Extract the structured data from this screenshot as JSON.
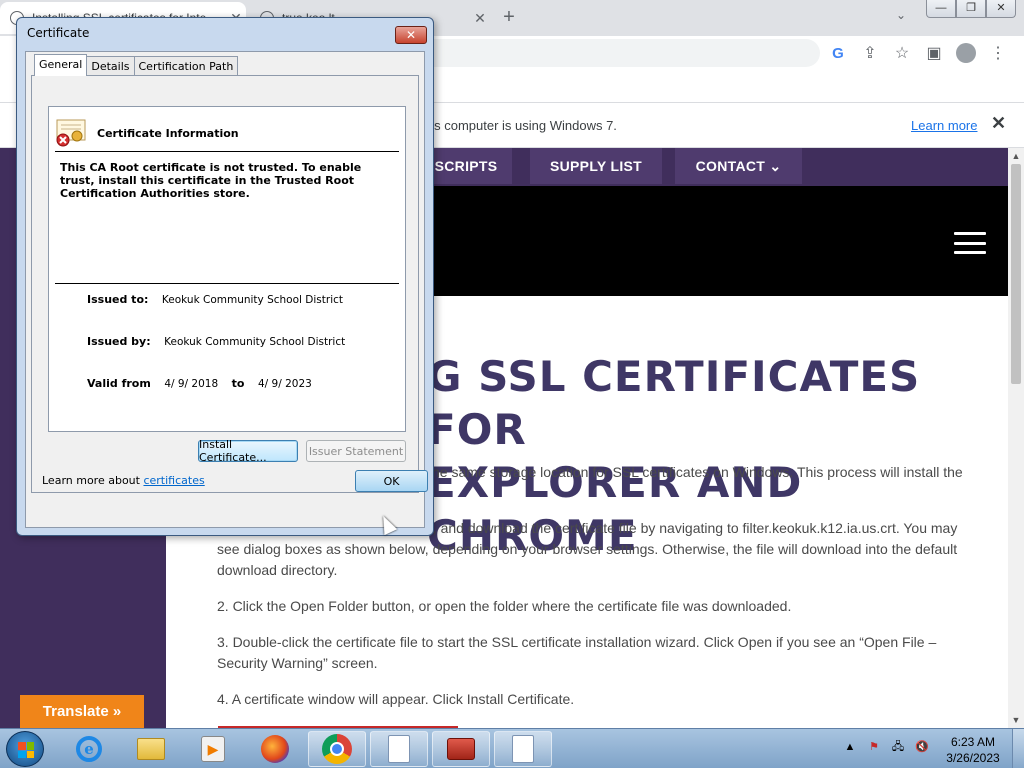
{
  "browser": {
    "tabs": [
      {
        "title": "Installing SSL certificates for Inte",
        "close": "✕"
      },
      {
        "title": "true.keo.lt",
        "close": "✕"
      }
    ],
    "new_tab": "+",
    "tab_search": "⌄",
    "window_controls": {
      "minimize": "—",
      "maximize": "❐",
      "close": "✕"
    },
    "toolbar_icons": [
      "google-icon",
      "share-icon",
      "star-icon",
      "sidepanel-icon",
      "profile-icon",
      "menu-icon"
    ],
    "toolbar": {
      "google": "G",
      "share": "⇪",
      "star": "☆",
      "sidepanel": "▣",
      "menu": "⋮"
    }
  },
  "infobar": {
    "text": "his computer is using Windows 7.",
    "link": "Learn more",
    "close": "✕"
  },
  "site": {
    "nav": [
      {
        "label": "SCRIPTS"
      },
      {
        "label": "SUPPLY LIST"
      },
      {
        "label": "CONTACT ⌄"
      }
    ],
    "heading_line1": "G SSL CERTIFICATES FOR",
    "heading_line2": "EXPLORER AND CHROME",
    "intro": "he same storage location for SSL certificates on Windows. This process will install the",
    "step1_a": "e, and download the certificate file by navigating to",
    "step1_link": "filter.keokuk.k12.ia.us.crt",
    "step1_b": ". You may see dialog boxes as shown below, depending on your browser settings. Otherwise, the file will download into the default download directory.",
    "step2": "2. Click the Open Folder button, or open the folder where the certificate file was downloaded.",
    "step3": "3. Double-click the certificate file to start the SSL certificate installation wizard. Click Open if you see an “Open File – Security Warning” screen.",
    "step4": "4. A certificate window will appear. Click Install Certificate.",
    "translate": "Translate »",
    "colors": {
      "nav_bg": "#402e5c",
      "heading": "#3f3766",
      "translate": "#f08519"
    }
  },
  "dialog": {
    "title": "Certificate",
    "close": "✕",
    "tabs": [
      "General",
      "Details",
      "Certification Path"
    ],
    "info_title": "Certificate Information",
    "warning": "This CA Root certificate is not trusted. To enable trust, install this certificate in the Trusted Root Certification Authorities store.",
    "issued_to_label": "Issued to:",
    "issued_to": "Keokuk Community School District",
    "issued_by_label": "Issued by:",
    "issued_by": "Keokuk Community School District",
    "valid_from_label": "Valid from",
    "valid_from": "4/ 9/ 2018",
    "valid_to_label": "to",
    "valid_to": "4/ 9/ 2023",
    "install_button": "Install Certificate...",
    "issuer_button": "Issuer Statement",
    "learn_more_prefix": "Learn more about",
    "learn_more_link": "certificates",
    "ok_button": "OK"
  },
  "taskbar": {
    "ie_glyph": "e",
    "media_glyph": "▶",
    "tray": {
      "arrow": "▲",
      "flag": "⚑",
      "network": "🖧",
      "volume": "🔇"
    },
    "time": "6:23 AM",
    "date": "3/26/2023"
  },
  "scrollbar": {
    "up": "▲",
    "down": "▼"
  }
}
